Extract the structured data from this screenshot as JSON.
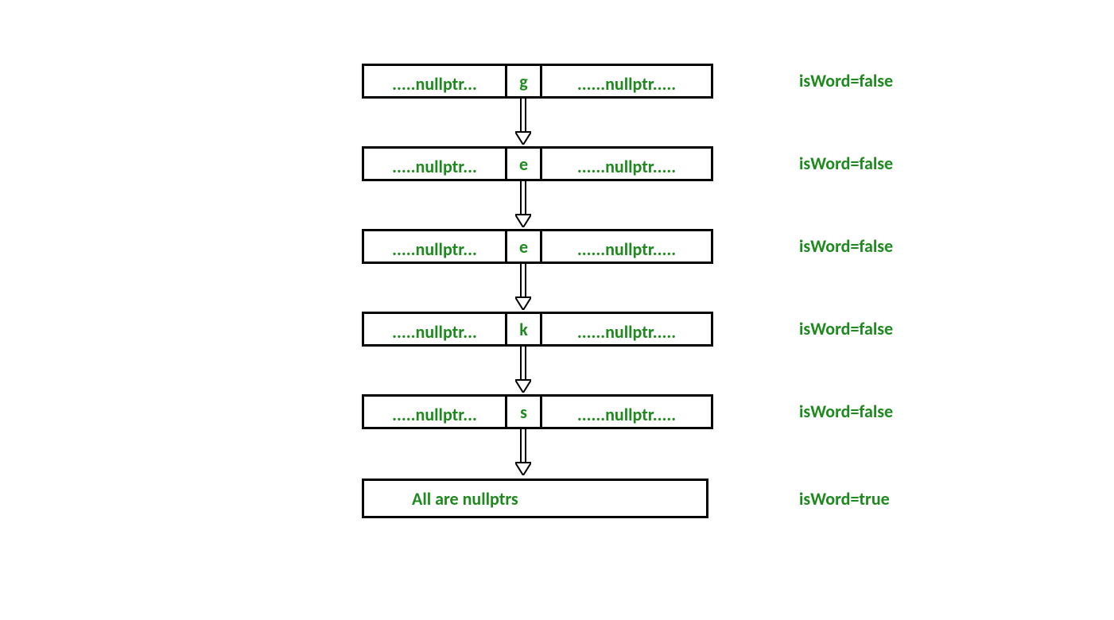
{
  "nodes": [
    {
      "left": ".....nullptr...",
      "mid": "g",
      "right": "......nullptr.....",
      "label": "isWord=false"
    },
    {
      "left": ".....nullptr...",
      "mid": "e",
      "right": "......nullptr.....",
      "label": "isWord=false"
    },
    {
      "left": ".....nullptr...",
      "mid": "e",
      "right": "......nullptr.....",
      "label": "isWord=false"
    },
    {
      "left": ".....nullptr...",
      "mid": "k",
      "right": "......nullptr.....",
      "label": "isWord=false"
    },
    {
      "left": ".....nullptr...",
      "mid": "s",
      "right": "......nullptr.....",
      "label": "isWord=false"
    }
  ],
  "final": {
    "text": "All are nullptrs",
    "label": "isWord=true"
  }
}
